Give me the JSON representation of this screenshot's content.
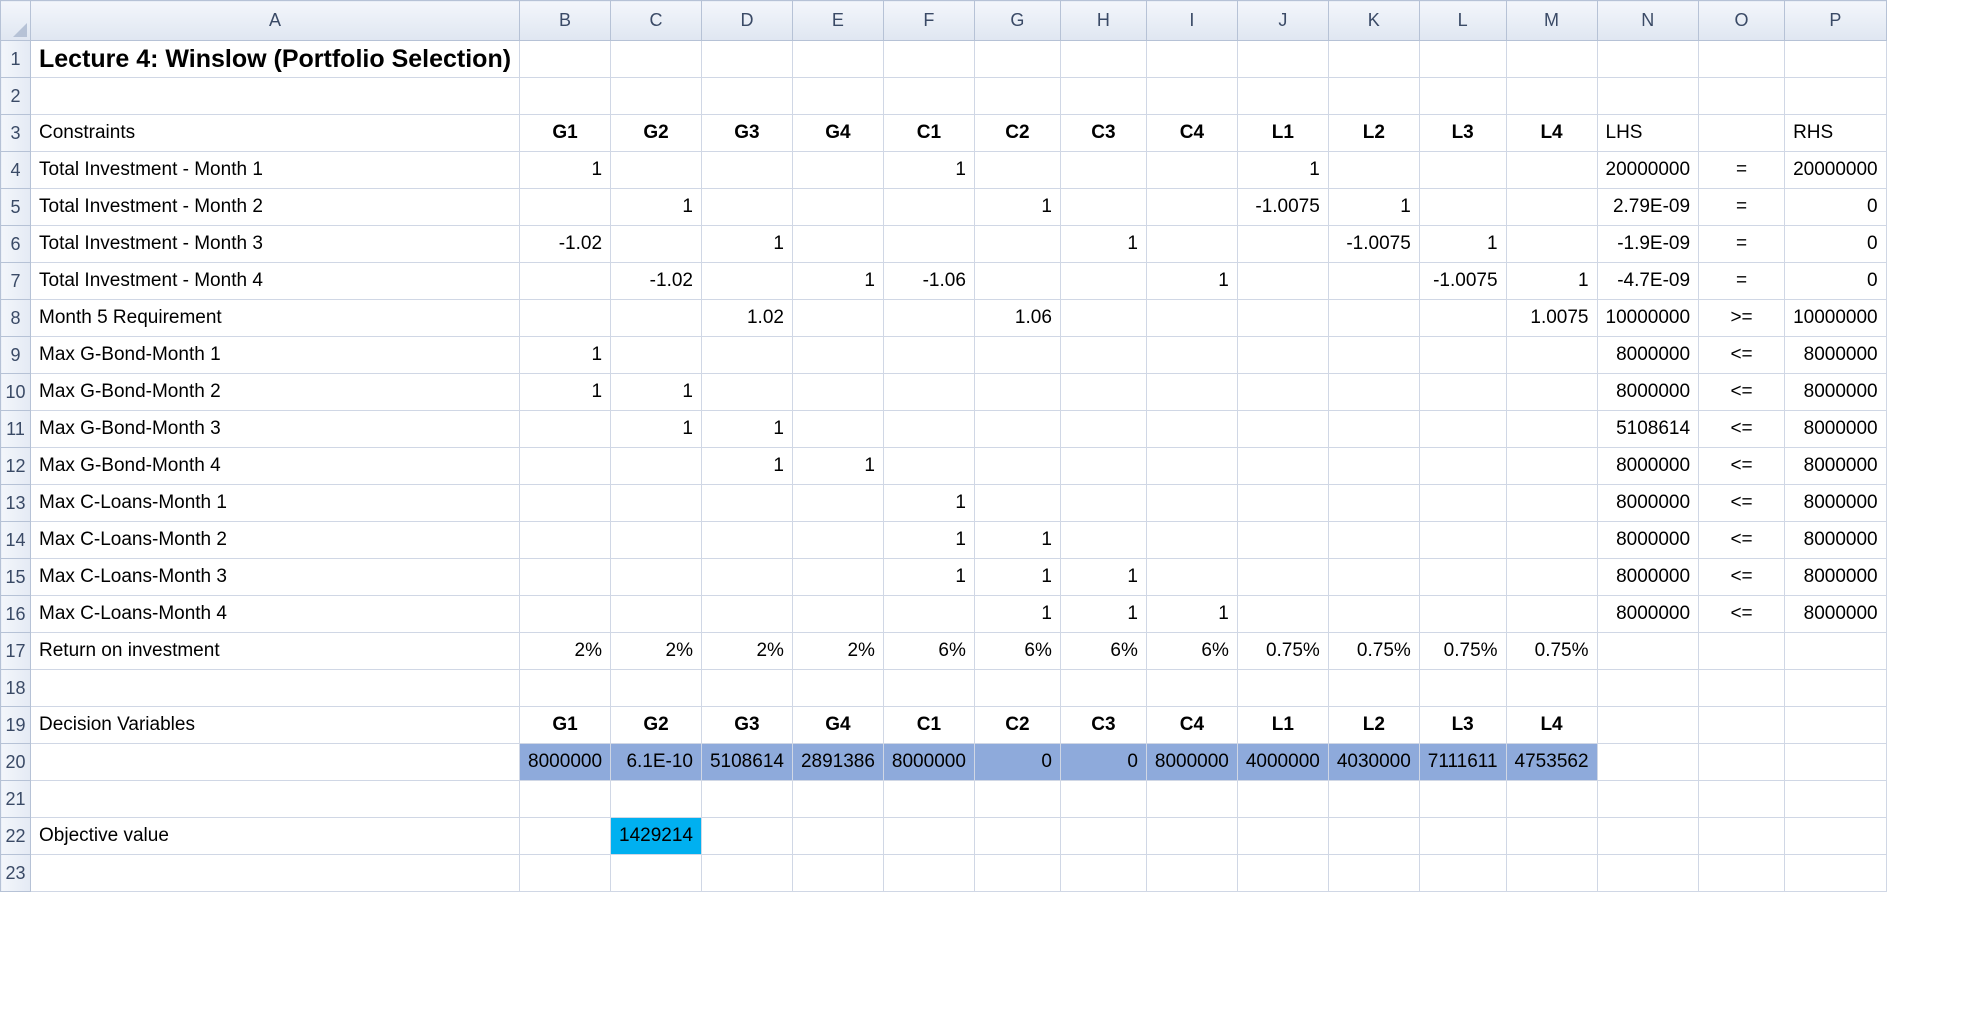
{
  "sheet": {
    "columns": [
      "A",
      "B",
      "C",
      "D",
      "E",
      "F",
      "G",
      "H",
      "I",
      "J",
      "K",
      "L",
      "M",
      "N",
      "O",
      "P"
    ],
    "title": "Lecture 4: Winslow (Portfolio Selection)",
    "constraint_header": {
      "label": "Constraints",
      "vars": [
        "G1",
        "G2",
        "G3",
        "G4",
        "C1",
        "C2",
        "C3",
        "C4",
        "L1",
        "L2",
        "L3",
        "L4"
      ],
      "lhs": "LHS",
      "rhs": "RHS"
    },
    "constraints": [
      {
        "row": "4",
        "label": "Total Investment - Month 1",
        "coef": [
          "1",
          "",
          "",
          "",
          "1",
          "",
          "",
          "",
          "1",
          "",
          "",
          ""
        ],
        "lhs": "20000000",
        "sign": "=",
        "rhs": "20000000"
      },
      {
        "row": "5",
        "label": "Total Investment - Month 2",
        "coef": [
          "",
          "1",
          "",
          "",
          "",
          "1",
          "",
          "",
          "-1.0075",
          "1",
          "",
          ""
        ],
        "lhs": "2.79E-09",
        "sign": "=",
        "rhs": "0"
      },
      {
        "row": "6",
        "label": "Total Investment - Month 3",
        "coef": [
          "-1.02",
          "",
          "1",
          "",
          "",
          "",
          "1",
          "",
          "",
          "-1.0075",
          "1",
          ""
        ],
        "lhs": "-1.9E-09",
        "sign": "=",
        "rhs": "0"
      },
      {
        "row": "7",
        "label": "Total Investment - Month 4",
        "coef": [
          "",
          "-1.02",
          "",
          "1",
          "-1.06",
          "",
          "",
          "1",
          "",
          "",
          "-1.0075",
          "1"
        ],
        "lhs": "-4.7E-09",
        "sign": "=",
        "rhs": "0"
      },
      {
        "row": "8",
        "label": "Month 5 Requirement",
        "coef": [
          "",
          "",
          "1.02",
          "",
          "",
          "1.06",
          "",
          "",
          "",
          "",
          "",
          "1.0075"
        ],
        "lhs": "10000000",
        "sign": ">=",
        "rhs": "10000000"
      },
      {
        "row": "9",
        "label": "Max G-Bond-Month 1",
        "coef": [
          "1",
          "",
          "",
          "",
          "",
          "",
          "",
          "",
          "",
          "",
          "",
          ""
        ],
        "lhs": "8000000",
        "sign": "<=",
        "rhs": "8000000"
      },
      {
        "row": "10",
        "label": "Max G-Bond-Month 2",
        "coef": [
          "1",
          "1",
          "",
          "",
          "",
          "",
          "",
          "",
          "",
          "",
          "",
          ""
        ],
        "lhs": "8000000",
        "sign": "<=",
        "rhs": "8000000"
      },
      {
        "row": "11",
        "label": "Max G-Bond-Month 3",
        "coef": [
          "",
          "1",
          "1",
          "",
          "",
          "",
          "",
          "",
          "",
          "",
          "",
          ""
        ],
        "lhs": "5108614",
        "sign": "<=",
        "rhs": "8000000"
      },
      {
        "row": "12",
        "label": "Max G-Bond-Month 4",
        "coef": [
          "",
          "",
          "1",
          "1",
          "",
          "",
          "",
          "",
          "",
          "",
          "",
          ""
        ],
        "lhs": "8000000",
        "sign": "<=",
        "rhs": "8000000"
      },
      {
        "row": "13",
        "label": "Max C-Loans-Month 1",
        "coef": [
          "",
          "",
          "",
          "",
          "1",
          "",
          "",
          "",
          "",
          "",
          "",
          ""
        ],
        "lhs": "8000000",
        "sign": "<=",
        "rhs": "8000000"
      },
      {
        "row": "14",
        "label": "Max C-Loans-Month 2",
        "coef": [
          "",
          "",
          "",
          "",
          "1",
          "1",
          "",
          "",
          "",
          "",
          "",
          ""
        ],
        "lhs": "8000000",
        "sign": "<=",
        "rhs": "8000000"
      },
      {
        "row": "15",
        "label": "Max C-Loans-Month 3",
        "coef": [
          "",
          "",
          "",
          "",
          "1",
          "1",
          "1",
          "",
          "",
          "",
          "",
          ""
        ],
        "lhs": "8000000",
        "sign": "<=",
        "rhs": "8000000"
      },
      {
        "row": "16",
        "label": "Max C-Loans-Month 4",
        "coef": [
          "",
          "",
          "",
          "",
          "",
          "1",
          "1",
          "1",
          "",
          "",
          "",
          ""
        ],
        "lhs": "8000000",
        "sign": "<=",
        "rhs": "8000000"
      }
    ],
    "returns": {
      "row": "17",
      "label": "Return on investment",
      "values": [
        "2%",
        "2%",
        "2%",
        "2%",
        "6%",
        "6%",
        "6%",
        "6%",
        "0.75%",
        "0.75%",
        "0.75%",
        "0.75%"
      ]
    },
    "decision": {
      "row_label": "19",
      "label": "Decision Variables",
      "vars": [
        "G1",
        "G2",
        "G3",
        "G4",
        "C1",
        "C2",
        "C3",
        "C4",
        "L1",
        "L2",
        "L3",
        "L4"
      ],
      "values_row": "20",
      "values": [
        "8000000",
        "6.1E-10",
        "5108614",
        "2891386",
        "8000000",
        "0",
        "0",
        "8000000",
        "4000000",
        "4030000",
        "7111611",
        "4753562"
      ]
    },
    "objective": {
      "row": "22",
      "label": "Objective value",
      "value": "1429214"
    },
    "empty_rows": [
      "2",
      "18",
      "21"
    ],
    "partial_row": "23",
    "colors": {
      "decision_fill": "#8eaadb",
      "objective_fill": "#00b0f0",
      "header_fill": "#dfe6f1",
      "gridline": "#d0d7e5"
    }
  }
}
